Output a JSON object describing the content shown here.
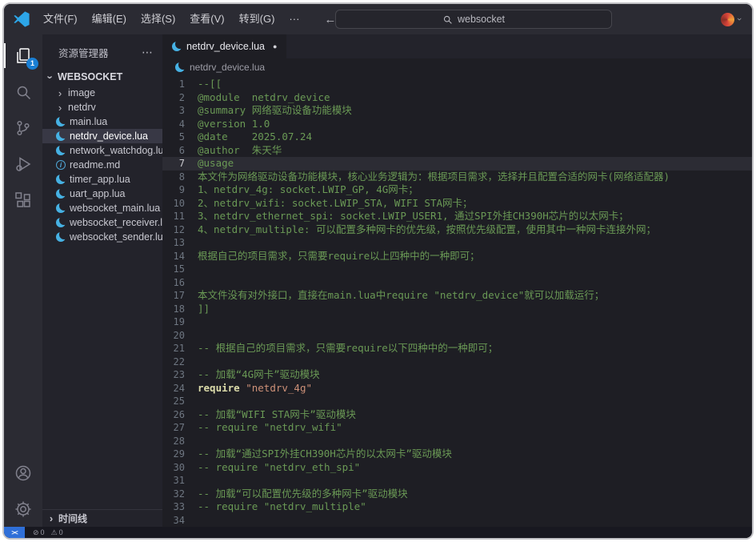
{
  "icons": {
    "chevron": "›",
    "more": "⋯",
    "modified_dot": "●",
    "error": "⊘",
    "warning": "⚠"
  },
  "titlebar": {
    "menus": [
      "文件(F)",
      "编辑(E)",
      "选择(S)",
      "查看(V)",
      "转到(G)",
      "···"
    ],
    "back": "←",
    "forward": "→",
    "search_value": "websocket"
  },
  "activitybar": {
    "badge": "1"
  },
  "sidebar": {
    "title": "资源管理器",
    "root": {
      "label": "WEBSOCKET"
    },
    "items": [
      {
        "label": "image",
        "icon": "folder"
      },
      {
        "label": "netdrv",
        "icon": "folder"
      },
      {
        "label": "main.lua",
        "icon": "lua"
      },
      {
        "label": "netdrv_device.lua",
        "icon": "lua",
        "selected": true
      },
      {
        "label": "network_watchdog.lua",
        "icon": "lua"
      },
      {
        "label": "readme.md",
        "icon": "info"
      },
      {
        "label": "timer_app.lua",
        "icon": "lua"
      },
      {
        "label": "uart_app.lua",
        "icon": "lua"
      },
      {
        "label": "websocket_main.lua",
        "icon": "lua"
      },
      {
        "label": "websocket_receiver.lua",
        "icon": "lua"
      },
      {
        "label": "websocket_sender.lua",
        "icon": "lua"
      }
    ],
    "timeline": {
      "label": "时间线"
    }
  },
  "editor": {
    "tab": {
      "label": "netdrv_device.lua",
      "modified": true
    },
    "breadcrumb": {
      "label": "netdrv_device.lua"
    },
    "active_line": 7,
    "lines": [
      {
        "n": 1,
        "parts": [
          {
            "t": "--[[",
            "c": "comment"
          }
        ]
      },
      {
        "n": 2,
        "parts": [
          {
            "t": "@module  netdrv_device",
            "c": "comment"
          }
        ]
      },
      {
        "n": 3,
        "parts": [
          {
            "t": "@summary 网络驱动设备功能模块",
            "c": "comment"
          }
        ]
      },
      {
        "n": 4,
        "parts": [
          {
            "t": "@version 1.0",
            "c": "comment"
          }
        ]
      },
      {
        "n": 5,
        "parts": [
          {
            "t": "@date    2025.07.24",
            "c": "comment"
          }
        ]
      },
      {
        "n": 6,
        "parts": [
          {
            "t": "@author  朱天华",
            "c": "comment"
          }
        ]
      },
      {
        "n": 7,
        "parts": [
          {
            "t": "@usage",
            "c": "comment"
          }
        ]
      },
      {
        "n": 8,
        "parts": [
          {
            "t": "本文件为网络驱动设备功能模块，核心业务逻辑为：根据项目需求，选择并且配置合适的网卡(网络适配器)",
            "c": "comment"
          }
        ]
      },
      {
        "n": 9,
        "parts": [
          {
            "t": "1、netdrv_4g: socket.LWIP_GP, 4G网卡；",
            "c": "comment"
          }
        ]
      },
      {
        "n": 10,
        "parts": [
          {
            "t": "2、netdrv_wifi: socket.LWIP_STA, WIFI STA网卡；",
            "c": "comment"
          }
        ]
      },
      {
        "n": 11,
        "parts": [
          {
            "t": "3、netdrv_ethernet_spi: socket.LWIP_USER1, 通过SPI外挂CH390H芯片的以太网卡；",
            "c": "comment"
          }
        ]
      },
      {
        "n": 12,
        "parts": [
          {
            "t": "4、netdrv_multiple: 可以配置多种网卡的优先级，按照优先级配置，使用其中一种网卡连接外网；",
            "c": "comment"
          }
        ]
      },
      {
        "n": 13,
        "parts": []
      },
      {
        "n": 14,
        "parts": [
          {
            "t": "根据自己的项目需求，只需要require以上四种中的一种即可；",
            "c": "comment"
          }
        ]
      },
      {
        "n": 15,
        "parts": []
      },
      {
        "n": 16,
        "parts": []
      },
      {
        "n": 17,
        "parts": [
          {
            "t": "本文件没有对外接口，直接在main.lua中require \"netdrv_device\"就可以加载运行；",
            "c": "comment"
          }
        ]
      },
      {
        "n": 18,
        "parts": [
          {
            "t": "]]",
            "c": "comment"
          }
        ]
      },
      {
        "n": 19,
        "parts": []
      },
      {
        "n": 20,
        "parts": []
      },
      {
        "n": 21,
        "parts": [
          {
            "t": "-- 根据自己的项目需求，只需要require以下四种中的一种即可；",
            "c": "comment"
          }
        ]
      },
      {
        "n": 22,
        "parts": []
      },
      {
        "n": 23,
        "parts": [
          {
            "t": "-- 加载“4G网卡”驱动模块",
            "c": "comment"
          }
        ]
      },
      {
        "n": 24,
        "parts": [
          {
            "t": "require",
            "c": "function"
          },
          {
            "t": " ",
            "c": "plain"
          },
          {
            "t": "\"netdrv_4g\"",
            "c": "string"
          }
        ]
      },
      {
        "n": 25,
        "parts": []
      },
      {
        "n": 26,
        "parts": [
          {
            "t": "-- 加载“WIFI STA网卡”驱动模块",
            "c": "comment"
          }
        ]
      },
      {
        "n": 27,
        "parts": [
          {
            "t": "-- require \"netdrv_wifi\"",
            "c": "comment"
          }
        ]
      },
      {
        "n": 28,
        "parts": []
      },
      {
        "n": 29,
        "parts": [
          {
            "t": "-- 加载“通过SPI外挂CH390H芯片的以太网卡”驱动模块",
            "c": "comment"
          }
        ]
      },
      {
        "n": 30,
        "parts": [
          {
            "t": "-- require \"netdrv_eth_spi\"",
            "c": "comment"
          }
        ]
      },
      {
        "n": 31,
        "parts": []
      },
      {
        "n": 32,
        "parts": [
          {
            "t": "-- 加载“可以配置优先级的多种网卡”驱动模块",
            "c": "comment"
          }
        ]
      },
      {
        "n": 33,
        "parts": [
          {
            "t": "-- require \"netdrv_multiple\"",
            "c": "comment"
          }
        ]
      },
      {
        "n": 34,
        "parts": []
      }
    ]
  },
  "statusbar": {
    "remote_label": "><",
    "error_count": "0",
    "warning_count": "0"
  }
}
